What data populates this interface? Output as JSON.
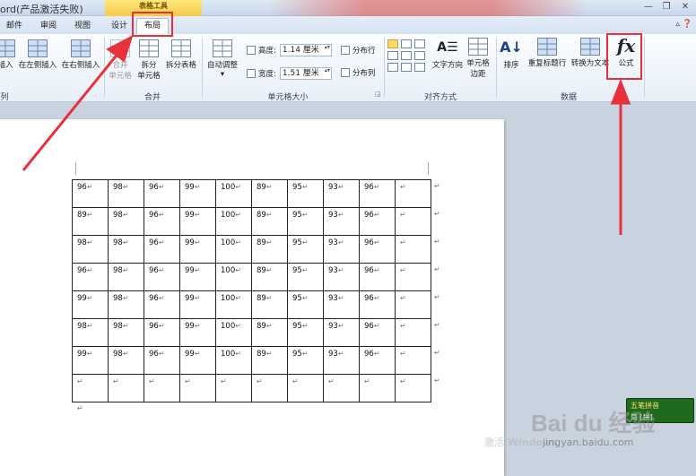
{
  "app": {
    "title": "ord(产品激活失败)",
    "context_group": "表格工具",
    "window_buttons": [
      "—",
      "❐",
      "✕"
    ]
  },
  "tabs": [
    {
      "label": "邮件",
      "active": false
    },
    {
      "label": "审阅",
      "active": false
    },
    {
      "label": "视图",
      "active": false
    },
    {
      "label": "设计",
      "active": false
    },
    {
      "label": "布局",
      "active": true
    }
  ],
  "ribbon": {
    "rows_cols": {
      "insert_above": "插入",
      "insert_left": "在左侧插入",
      "insert_right": "在右侧插入",
      "group_label": "列"
    },
    "merge": {
      "merge_cells": [
        "合并",
        "单元格"
      ],
      "split_cells": [
        "拆分",
        "单元格"
      ],
      "split_table": "拆分表格",
      "group_label": "合并"
    },
    "cell_size": {
      "autofit": "自动调整",
      "height_label": "高度:",
      "height_value": "1.14 厘米",
      "width_label": "宽度:",
      "width_value": "1.51 厘米",
      "distribute_rows": "分布行",
      "distribute_cols": "分布列",
      "group_label": "单元格大小"
    },
    "alignment": {
      "text_direction": "文字方向",
      "cell_margins": [
        "单元格",
        "边距"
      ],
      "group_label": "对齐方式"
    },
    "data": {
      "sort": "排序",
      "repeat_header": "重复标题行",
      "convert_to_text": "转换为文本",
      "formula": "公式",
      "group_label": "数据"
    }
  },
  "table": {
    "rows": [
      [
        "96",
        "98",
        "96",
        "99",
        "100",
        "89",
        "95",
        "93",
        "96",
        ""
      ],
      [
        "89",
        "98",
        "96",
        "99",
        "100",
        "89",
        "95",
        "93",
        "96",
        ""
      ],
      [
        "98",
        "98",
        "96",
        "99",
        "100",
        "89",
        "95",
        "93",
        "96",
        ""
      ],
      [
        "96",
        "98",
        "96",
        "99",
        "100",
        "89",
        "95",
        "93",
        "96",
        ""
      ],
      [
        "99",
        "98",
        "96",
        "99",
        "100",
        "89",
        "95",
        "93",
        "96",
        ""
      ],
      [
        "98",
        "98",
        "96",
        "99",
        "100",
        "89",
        "95",
        "93",
        "96",
        ""
      ],
      [
        "99",
        "98",
        "96",
        "99",
        "100",
        "89",
        "95",
        "93",
        "96",
        ""
      ],
      [
        "",
        "",
        "",
        "",
        "",
        "",
        "",
        "",
        "",
        ""
      ]
    ],
    "mark": "↵"
  },
  "ime": {
    "line1": "五笔拼音",
    "line2": "简 [拼]"
  },
  "watermark": {
    "logo": "Bai du 经验",
    "url": "jingyan.baidu.com",
    "faint": "激活 Windows"
  },
  "colors": {
    "highlight": "#e8313a",
    "context_tab": "#f5c84a",
    "ime": "#1f6a1f"
  }
}
